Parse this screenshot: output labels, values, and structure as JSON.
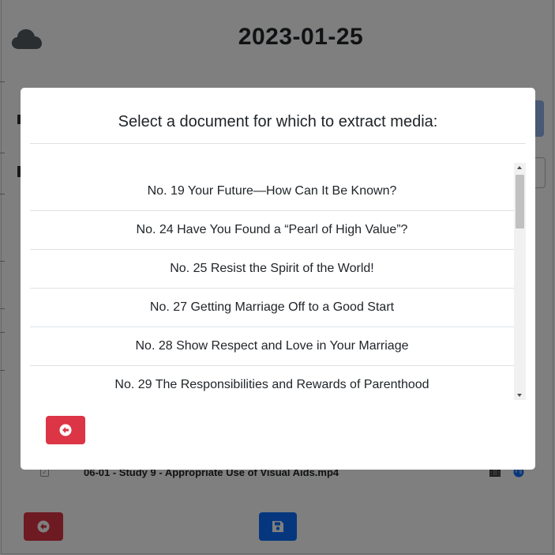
{
  "header": {
    "date": "2023-01-25",
    "cloud_icon": "cloud-icon"
  },
  "background": {
    "row": {
      "filename": "06-01 - Study 9 - Appropriate Use of Visual Aids.mp4",
      "checkbox_icon": "checkbox-icon",
      "film_icon": "film-icon",
      "globe_icon": "globe-icon"
    },
    "back_icon": "arrow-circle-left-icon",
    "save_icon": "floppy-disk-icon"
  },
  "modal": {
    "title": "Select a document for which to extract media:",
    "documents": [
      "No. 19 Your Future—How Can It Be Known?",
      "No. 24 Have You Found a “Pearl of High Value”?",
      "No. 25 Resist the Spirit of the World!",
      "No. 27 Getting Marriage Off to a Good Start",
      "No. 28 Show Respect and Love in Your Marriage",
      "No. 29 The Responsibilities and Rewards of Parenthood"
    ],
    "back_icon": "arrow-circle-left-icon"
  },
  "colors": {
    "danger": "#dc3545",
    "primary": "#0d6efd",
    "text": "#212529",
    "cloud": "#555c63"
  }
}
